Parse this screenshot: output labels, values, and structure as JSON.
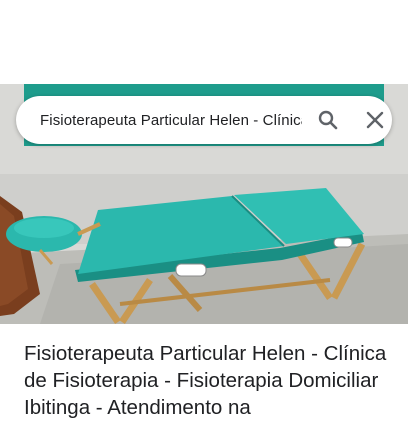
{
  "search": {
    "query": "Fisioterapeuta Particular Helen - Clínica de Fisioterapia"
  },
  "icons": {
    "search": "search-icon",
    "close": "close-icon"
  },
  "colors": {
    "table_teal": "#2bb8ad",
    "frame_teal": "#1e9c8c",
    "wood": "#c99a52"
  },
  "result": {
    "title": "Fisioterapeuta Particular Helen - Clínica de Fisioterapia - Fisioterapia Domiciliar Ibitinga - Atendimento na"
  }
}
